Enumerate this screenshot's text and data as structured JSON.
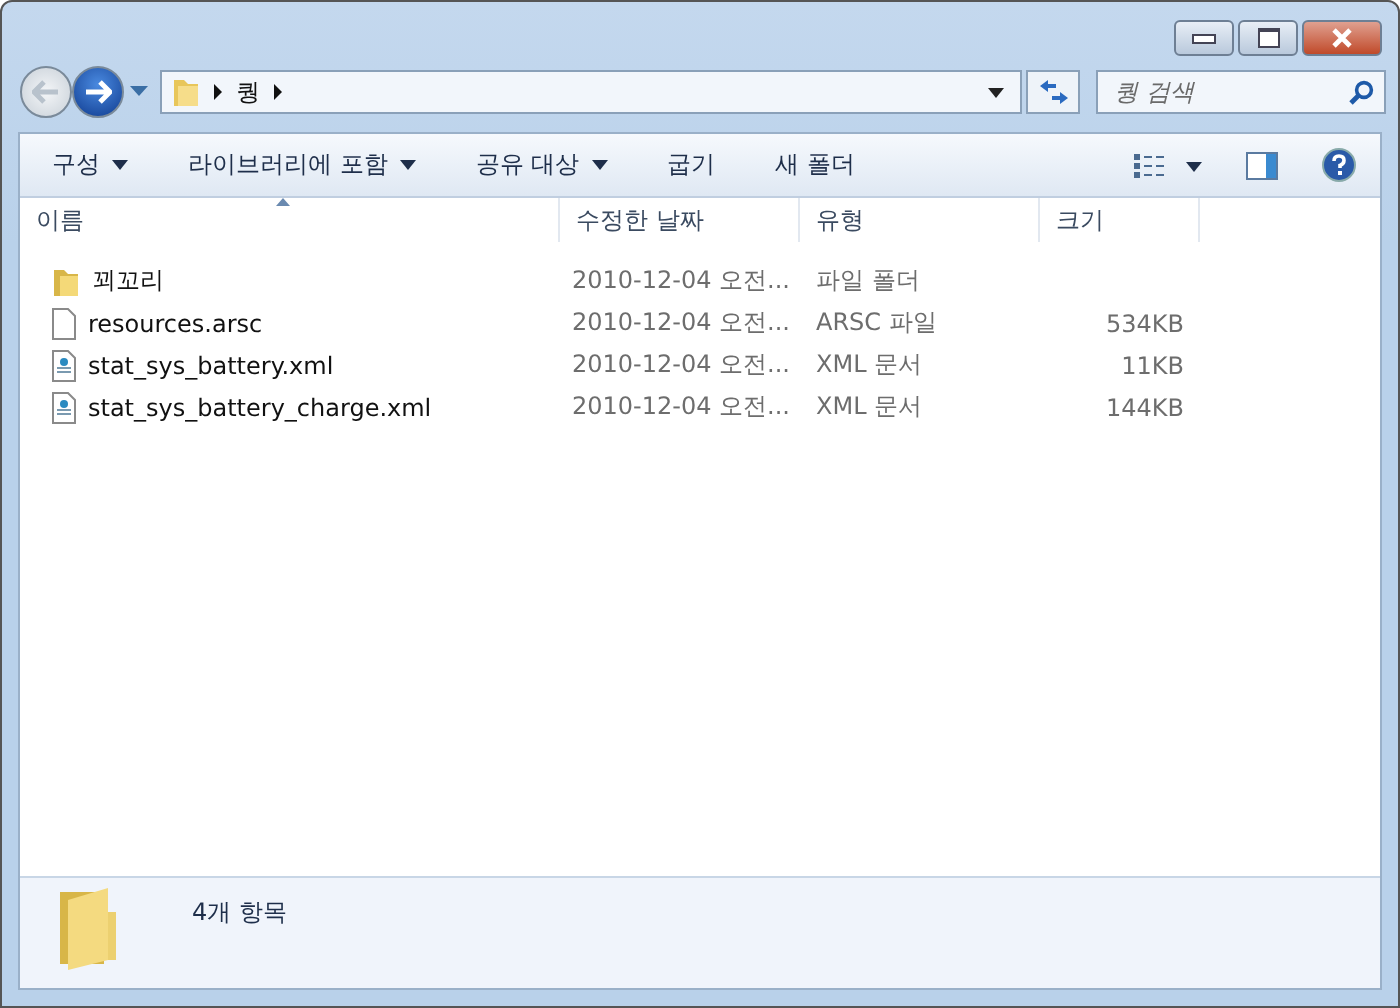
{
  "address_bar": {
    "path": [
      "퀑"
    ]
  },
  "search": {
    "placeholder": "퀑 검색"
  },
  "toolbar": {
    "items": [
      {
        "label": "구성",
        "dropdown": true
      },
      {
        "label": "라이브러리에 포함",
        "dropdown": true
      },
      {
        "label": "공유 대상",
        "dropdown": true
      },
      {
        "label": "굽기",
        "dropdown": false
      },
      {
        "label": "새 폴더",
        "dropdown": false
      }
    ]
  },
  "columns": [
    "이름",
    "수정한 날짜",
    "유형",
    "크기"
  ],
  "files": [
    {
      "kind": "folder",
      "name": "꾀꼬리",
      "date": "2010-12-04 오전...",
      "type": "파일 폴더"
    },
    {
      "kind": "file",
      "name": "resources.arsc",
      "date": "2010-12-04 오전...",
      "type": "ARSC 파일",
      "size": "534KB"
    },
    {
      "kind": "xml",
      "name": "stat_sys_battery.xml",
      "date": "2010-12-04 오전...",
      "type": "XML 문서",
      "size": "11KB"
    },
    {
      "kind": "xml",
      "name": "stat_sys_battery_charge.xml",
      "date": "2010-12-04 오전...",
      "type": "XML 문서",
      "size": "144KB"
    }
  ],
  "status_bar": {
    "count": "4개 항목"
  }
}
